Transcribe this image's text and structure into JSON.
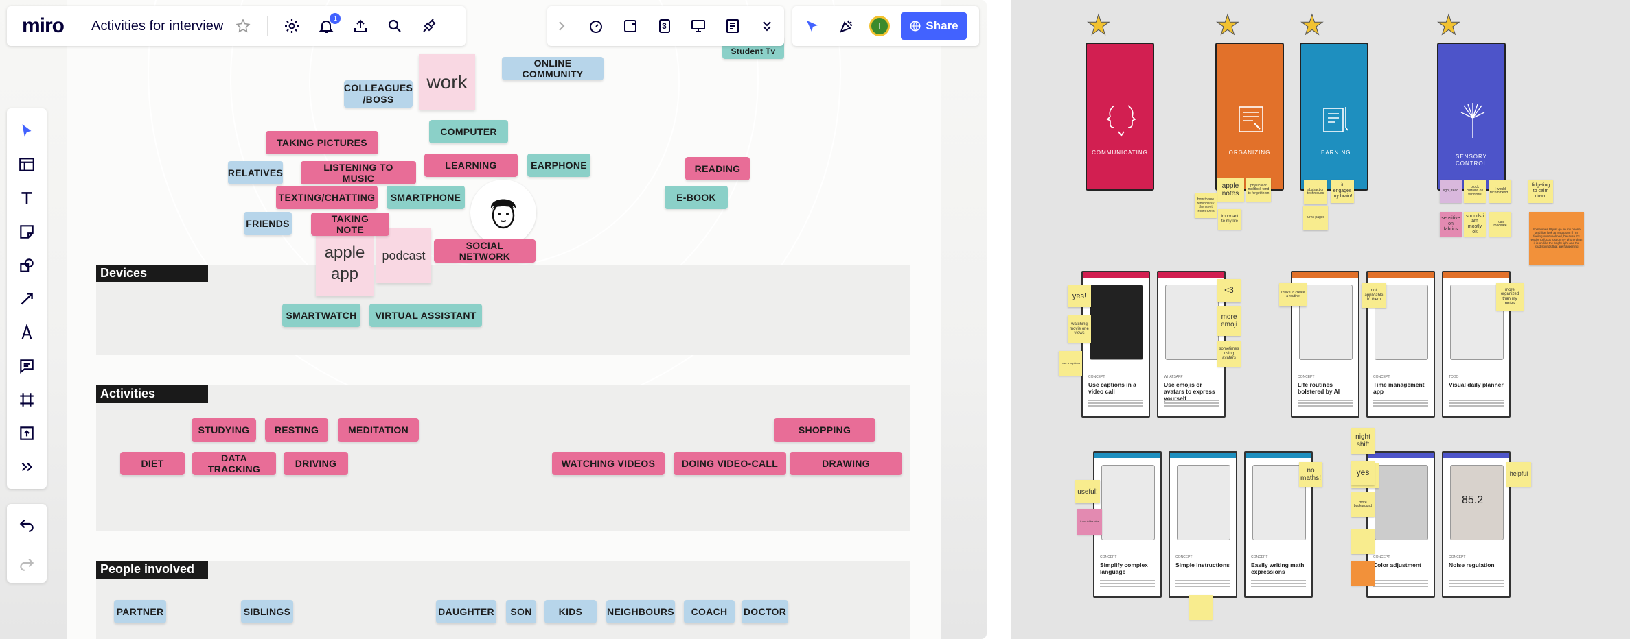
{
  "app": {
    "logo": "miro",
    "board_title": "Activities for interview",
    "notification_count": "1",
    "share_label": "Share",
    "user_initial": "I",
    "frame_counter": "3"
  },
  "board": {
    "work_sticky": "work",
    "apple_sticky": "apple app",
    "podcast_sticky": "podcast",
    "partial_top_tag": "Student Tv",
    "tags": {
      "colleagues": "COLLEAGUES /BOSS",
      "online_community": "ONLINE COMMUNITY",
      "taking_pictures": "TAKING PICTURES",
      "computer": "COMPUTER",
      "relatives": "RELATIVES",
      "listening_music": "LISTENING TO MUSIC",
      "learning": "LEARNING",
      "earphone": "EARPHONE",
      "reading": "READING",
      "texting": "TEXTING/CHATTING",
      "smartphone": "SMARTPHONE",
      "ebook": "E-BOOK",
      "friends": "FRIENDS",
      "taking_note": "TAKING NOTE",
      "social_network": "SOCIAL NETWORK",
      "smartwatch": "SMARTWATCH",
      "virtual_assistant": "VIRTUAL ASSISTANT",
      "studying": "STUDYING",
      "resting": "RESTING",
      "meditation": "MEDITATION",
      "shopping": "SHOPPING",
      "diet": "DIET",
      "data_tracking": "DATA TRACKING",
      "driving": "DRIVING",
      "watching_videos": "WATCHING VIDEOS",
      "video_call": "DOING VIDEO-CALL",
      "drawing": "DRAWING",
      "partner": "PARTNER",
      "siblings": "SIBLINGS",
      "daughter": "DAUGHTER",
      "son": "SON",
      "kids": "KIDS",
      "neighbours": "NEIGHBOURS",
      "coach": "COACH",
      "doctor": "DOCTOR"
    },
    "sections": {
      "devices": "Devices",
      "activities": "Activities",
      "people": "People involved"
    }
  },
  "right_board": {
    "categories": [
      {
        "label": "COMMUNICATING",
        "color": "#d21f51"
      },
      {
        "label": "ORGANIZING",
        "color": "#e2712a"
      },
      {
        "label": "LEARNING",
        "color": "#1e8fbf"
      },
      {
        "label": "SENSORY CONTROL",
        "color": "#4d54c9"
      }
    ],
    "notes": {
      "apple_notes": "apple notes",
      "physical_walls": "physical or mulitlock tend to forget them",
      "how_remember": "how to see reminders / the rseet remembers",
      "important_life": "important to my life",
      "abstract": "abstract or techniques",
      "engages_brain": "it engages my brain!",
      "turns_pages": "turns pages",
      "light": "light, read",
      "block_curtains": "block curtains on windows",
      "noise": "I would recommend...",
      "fidgeting": "fidgeting to calm down",
      "sensitive": "sensitive on fabrics",
      "sounds": "sounds i am mostly ok",
      "meditate": "i can meditate",
      "long_orange": "Sometimes I'll just go on my phone and like look at Instagram if I'm feeling overwhelmed, because it's easier to focus just on my phone than it is on like the bright light and the loud sounds that are happening",
      "yes1": "yes!",
      "watching": "watching movie one views",
      "small1": "I use a captions",
      "heart": "<3",
      "more_emoji": "more emoji",
      "sometimes_avatars": "sometimes using avatars",
      "routines": "I'd like to create a routine",
      "not_applicable": "not applicable to them",
      "more_organized": "more organized than my notes",
      "useful": "useful!",
      "night_shift": "night shift",
      "yes2": "yes",
      "more_background": "more background",
      "no_maths": "no maths!",
      "helpful": "helpful",
      "small2": "it would be nice"
    },
    "mockups_row1": [
      {
        "sub": "CONCEPT",
        "caption": "Use captions in a video call"
      },
      {
        "sub": "WHATSAPP",
        "caption": "Use emojis or avatars to express yourself"
      },
      {
        "sub": "CONCEPT",
        "caption": "Life routines bolstered by AI"
      },
      {
        "sub": "CONCEPT",
        "caption": "Time management app"
      },
      {
        "sub": "TODO",
        "caption": "Visual daily planner"
      }
    ],
    "mockups_row2": [
      {
        "sub": "CONCEPT",
        "caption": "Simplify complex language"
      },
      {
        "sub": "CONCEPT",
        "caption": "Simple instructions"
      },
      {
        "sub": "CONCEPT",
        "caption": "Easily writing math expressions"
      },
      {
        "sub": "CONCEPT",
        "caption": "Color adjustment"
      },
      {
        "sub": "CONCEPT",
        "caption": "Noise regulation"
      }
    ],
    "noise_reading": "85.2"
  }
}
